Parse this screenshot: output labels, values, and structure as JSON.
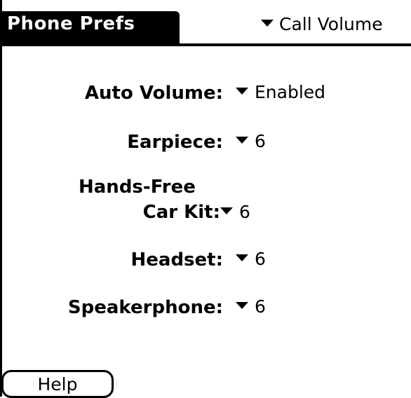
{
  "app": {
    "title": "Phone Prefs"
  },
  "header": {
    "category_picker": {
      "selected": "Call Volume"
    }
  },
  "settings": {
    "auto_volume": {
      "label": "Auto Volume:",
      "value": "Enabled"
    },
    "earpiece": {
      "label": "Earpiece:",
      "value": "6"
    },
    "hands_free": {
      "label_line1": "Hands-Free",
      "label_line2": "Car Kit:",
      "value": "6"
    },
    "headset": {
      "label": "Headset:",
      "value": "6"
    },
    "speakerphone": {
      "label": "Speakerphone:",
      "value": "6"
    }
  },
  "footer": {
    "help_label": "Help"
  },
  "icons": {
    "picker_arrow": "triangle-down-icon"
  },
  "colors": {
    "foreground": "#000000",
    "background": "#ffffff"
  }
}
